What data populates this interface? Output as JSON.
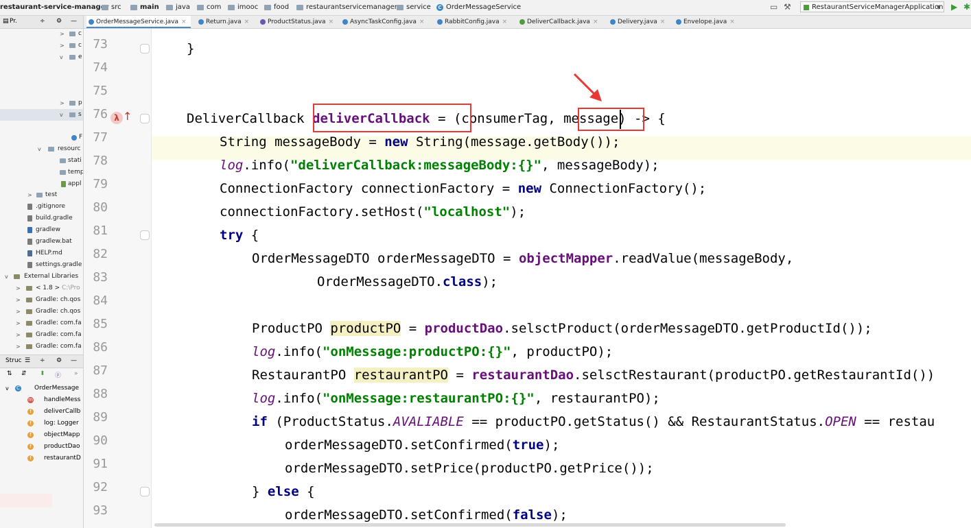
{
  "breadcrumb": [
    "restaurant-service-manager",
    "src",
    "main",
    "java",
    "com",
    "imooc",
    "food",
    "restaurantservicemanager",
    "service",
    "OrderMessageService"
  ],
  "run_config": "RestaurantServiceManagerApplication",
  "project_panel": {
    "title": "Pr.",
    "items": [
      {
        "label": "c",
        "arrow": ">"
      },
      {
        "label": "c",
        "arrow": ">"
      },
      {
        "label": "e",
        "arrow": "v"
      },
      {
        "label": "p",
        "arrow": ">"
      },
      {
        "label": "s",
        "arrow": "v"
      },
      {
        "label": "F",
        "arrow": ""
      },
      {
        "label": "resourc",
        "arrow": "v"
      },
      {
        "label": "stati",
        "arrow": ""
      },
      {
        "label": "temp",
        "arrow": ""
      },
      {
        "label": "appl",
        "arrow": ""
      },
      {
        "label": "test",
        "arrow": ">"
      },
      {
        "label": ".gitignore",
        "arrow": ""
      },
      {
        "label": "build.gradle",
        "arrow": ""
      },
      {
        "label": "gradlew",
        "arrow": ""
      },
      {
        "label": "gradlew.bat",
        "arrow": ""
      },
      {
        "label": "HELP.md",
        "arrow": ""
      },
      {
        "label": "settings.gradle",
        "arrow": ""
      },
      {
        "label": "External Libraries",
        "arrow": "v"
      },
      {
        "label": "< 1.8 >",
        "arrow": ">",
        "suffix": "C:\\Pro"
      },
      {
        "label": "Gradle: ch.qos",
        "arrow": ">"
      },
      {
        "label": "Gradle: ch.qos",
        "arrow": ">"
      },
      {
        "label": "Gradle: com.fa",
        "arrow": ">"
      },
      {
        "label": "Gradle: com.fa",
        "arrow": ">"
      },
      {
        "label": "Gradle: com.fa",
        "arrow": ">"
      }
    ]
  },
  "structure_panel": {
    "title": "Struc",
    "items": [
      {
        "label": "OrderMessage",
        "badge": "C"
      },
      {
        "label": "handleMess",
        "badge": "m"
      },
      {
        "label": "deliverCallb",
        "badge": "f"
      },
      {
        "label": "log: Logger",
        "badge": "f"
      },
      {
        "label": "objectMapp",
        "badge": "f"
      },
      {
        "label": "productDao",
        "badge": "f"
      },
      {
        "label": "restaurantD",
        "badge": "f"
      }
    ]
  },
  "tabs": [
    {
      "label": "OrderMessageService.java",
      "active": true
    },
    {
      "label": "Return.java"
    },
    {
      "label": "ProductStatus.java"
    },
    {
      "label": "AsyncTaskConfig.java"
    },
    {
      "label": "RabbitConfig.java"
    },
    {
      "label": "DeliverCallback.java"
    },
    {
      "label": "Delivery.java"
    },
    {
      "label": "Envelope.java"
    }
  ],
  "line_numbers": [
    "73",
    "74",
    "75",
    "76",
    "77",
    "78",
    "79",
    "80",
    "81",
    "82",
    "83",
    "84",
    "85",
    "86",
    "87",
    "88",
    "89",
    "90",
    "91",
    "92",
    "93"
  ],
  "code": {
    "l73": "}",
    "l76a": "DeliverCallback ",
    "l76b": "deliverCallback",
    "l76c": " = (consumerTag, ",
    "l76d": "message",
    "l76e": ") -> {",
    "l77a": "String messageBody = ",
    "l77b": "new",
    "l77c": " String(message.getBody());",
    "l78a": "log",
    "l78b": ".info(",
    "l78c": "\"deliverCallback:messageBody:{}\"",
    "l78d": ", messageBody);",
    "l79a": "ConnectionFactory connectionFactory = ",
    "l79b": "new",
    "l79c": " ConnectionFactory();",
    "l80a": "connectionFactory.setHost(",
    "l80b": "\"localhost\"",
    "l80c": ");",
    "l81a": "try",
    "l81b": " {",
    "l82a": "OrderMessageDTO orderMessageDTO = ",
    "l82b": "objectMapper",
    "l82c": ".readValue(messageBody,",
    "l83a": "OrderMessageDTO.",
    "l83b": "class",
    "l83c": ");",
    "l85a": "ProductPO ",
    "l85b": "productPO",
    "l85c": " = ",
    "l85d": "productDao",
    "l85e": ".selsctProduct(orderMessageDTO.getProductId());",
    "l86a": "log",
    "l86b": ".info(",
    "l86c": "\"onMessage:productPO:{}\"",
    "l86d": ", productPO);",
    "l87a": "RestaurantPO ",
    "l87b": "restaurantPO",
    "l87c": " = ",
    "l87d": "restaurantDao",
    "l87e": ".selsctRestaurant(productPO.getRestaurantId())",
    "l88a": "log",
    "l88b": ".info(",
    "l88c": "\"onMessage:restaurantPO:{}\"",
    "l88d": ", restaurantPO);",
    "l89a": "if",
    "l89b": " (ProductStatus.",
    "l89c": "AVALIABLE",
    "l89d": " == productPO.getStatus() && RestaurantStatus.",
    "l89e": "OPEN",
    "l89f": " == restau",
    "l90a": "orderMessageDTO.setConfirmed(",
    "l90b": "true",
    "l90c": ");",
    "l91": "orderMessageDTO.setPrice(productPO.getPrice());",
    "l92a": "} ",
    "l92b": "else",
    "l92c": " {",
    "l93a": "orderMessageDTO.setConfirmed(",
    "l93b": "false",
    "l93c": ");"
  }
}
